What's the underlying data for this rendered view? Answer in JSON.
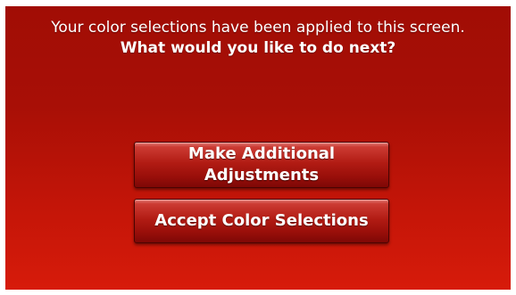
{
  "dialog": {
    "message_line1": "Your color selections have been applied to this screen.",
    "message_line2": "What would you like to do next?"
  },
  "buttons": {
    "additional_line1": "Make Additional",
    "additional_line2": "Adjustments",
    "accept_label": "Accept Color Selections"
  },
  "colors": {
    "background_top": "#a10d05",
    "background_bottom": "#d71b0a",
    "button_border": "#4a0402",
    "text": "#ffffff"
  }
}
